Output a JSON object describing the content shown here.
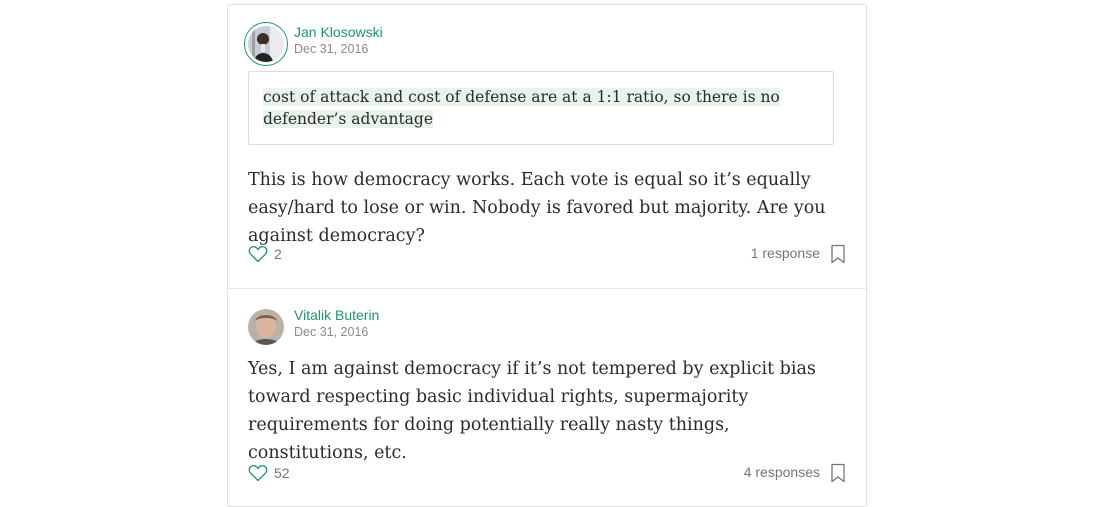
{
  "responses": [
    {
      "author": "Jan Klosowski",
      "date": "Dec 31, 2016",
      "quote": "cost of attack and cost of defense are at a 1:1 ratio, so there is no defender’s advantage",
      "body": "This is how democracy works. Each vote is equal so it’s equally easy/hard to lose or win. Nobody is favored but majority. Are you against democracy?",
      "likes": "2",
      "responses_label": "1 response"
    },
    {
      "author": "Vitalik Buterin",
      "date": "Dec 31, 2016",
      "body": "Yes, I am against democracy if it’s not tempered by explicit bias toward respecting basic individual rights, supermajority requirements for doing potentially really nasty things, constitutions, etc.",
      "likes": "52",
      "responses_label": "4 responses"
    }
  ],
  "colors": {
    "accent": "#1c9963",
    "highlight": "#e8f3ec",
    "muted": "#757575"
  },
  "icons": [
    "heart-icon",
    "bookmark-icon"
  ]
}
